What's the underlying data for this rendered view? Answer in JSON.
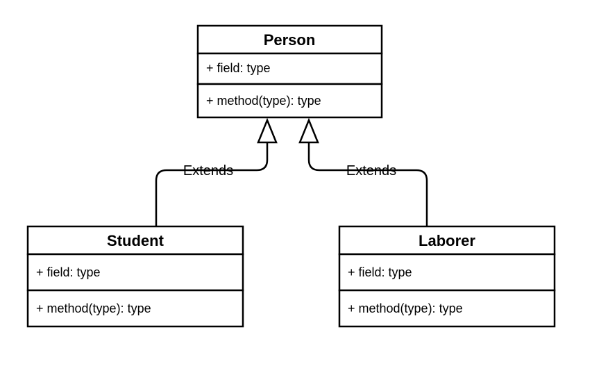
{
  "chart_data": {
    "type": "uml-class-diagram",
    "classes": [
      {
        "id": "person",
        "name": "Person",
        "fields": [
          "+ field: type"
        ],
        "methods": [
          "+ method(type): type"
        ]
      },
      {
        "id": "student",
        "name": "Student",
        "fields": [
          "+ field: type"
        ],
        "methods": [
          "+ method(type): type"
        ]
      },
      {
        "id": "laborer",
        "name": "Laborer",
        "fields": [
          "+ field: type"
        ],
        "methods": [
          "+ method(type): type"
        ]
      }
    ],
    "relationships": [
      {
        "from": "student",
        "to": "person",
        "kind": "generalization",
        "label": "Extends"
      },
      {
        "from": "laborer",
        "to": "person",
        "kind": "generalization",
        "label": "Extends"
      }
    ]
  }
}
